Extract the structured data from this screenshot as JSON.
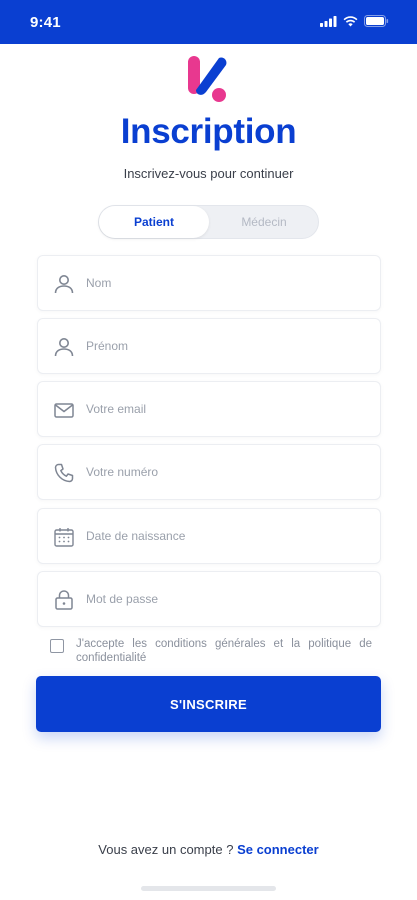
{
  "status_bar": {
    "time": "9:41"
  },
  "header": {
    "title": "Inscription",
    "subtitle": "Inscrivez-vous pour continuer"
  },
  "role_toggle": {
    "options": [
      "Patient",
      "Médecin"
    ],
    "selected": "Patient"
  },
  "form": {
    "fields": [
      {
        "icon": "user-icon",
        "placeholder": "Nom",
        "value": ""
      },
      {
        "icon": "user-icon",
        "placeholder": "Prénom",
        "value": ""
      },
      {
        "icon": "envelope-icon",
        "placeholder": "Votre email",
        "value": ""
      },
      {
        "icon": "phone-icon",
        "placeholder": "Votre numéro",
        "value": ""
      },
      {
        "icon": "calendar-icon",
        "placeholder": "Date de naissance",
        "value": ""
      },
      {
        "icon": "lock-icon",
        "placeholder": "Mot de passe",
        "value": ""
      }
    ],
    "terms_text": "J'accepte les conditions générales et la politique de confidentialité",
    "terms_checked": false,
    "submit_label": "S'INSCRIRE"
  },
  "footer": {
    "prompt": "Vous avez un compte ?",
    "link_label": "Se connecter"
  },
  "colors": {
    "primary": "#0a3fd1",
    "logo_pink": "#e8388f",
    "logo_blue": "#0a3fd1"
  }
}
